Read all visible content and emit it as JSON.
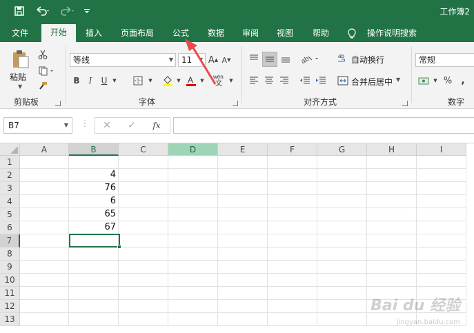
{
  "title_bar": {
    "workbook_title": "工作簿2"
  },
  "tabs": [
    {
      "label": "文件"
    },
    {
      "label": "开始"
    },
    {
      "label": "插入"
    },
    {
      "label": "页面布局"
    },
    {
      "label": "公式"
    },
    {
      "label": "数据"
    },
    {
      "label": "审阅"
    },
    {
      "label": "视图"
    },
    {
      "label": "帮助"
    },
    {
      "label": "操作说明搜索"
    }
  ],
  "ribbon": {
    "clipboard": {
      "paste_label": "粘贴",
      "group_label": "剪贴板"
    },
    "font": {
      "font_name": "等线",
      "font_size": "11",
      "group_label": "字体"
    },
    "alignment": {
      "wrap_text": "自动换行",
      "merge_center": "合并后居中",
      "group_label": "对齐方式"
    },
    "number": {
      "format": "常规",
      "group_label": "数字"
    }
  },
  "formula_bar": {
    "name_box": "B7",
    "formula_value": ""
  },
  "grid": {
    "columns": [
      "A",
      "B",
      "C",
      "D",
      "E",
      "F",
      "G",
      "H",
      "I"
    ],
    "rows": [
      "1",
      "2",
      "3",
      "4",
      "5",
      "6",
      "7",
      "8",
      "9",
      "10",
      "11",
      "12",
      "13"
    ],
    "column_b_values": [
      "",
      "4",
      "76",
      "6",
      "65",
      "67",
      "",
      "",
      "",
      "",
      "",
      "",
      ""
    ],
    "selected_cell": "B7"
  },
  "watermark": {
    "main": "Bai du 经验",
    "sub": "jingyan.baidu.com"
  },
  "colors": {
    "accent": "#217346",
    "highlight_column": "#9fd5b7",
    "arrow": "#e84a4a"
  }
}
